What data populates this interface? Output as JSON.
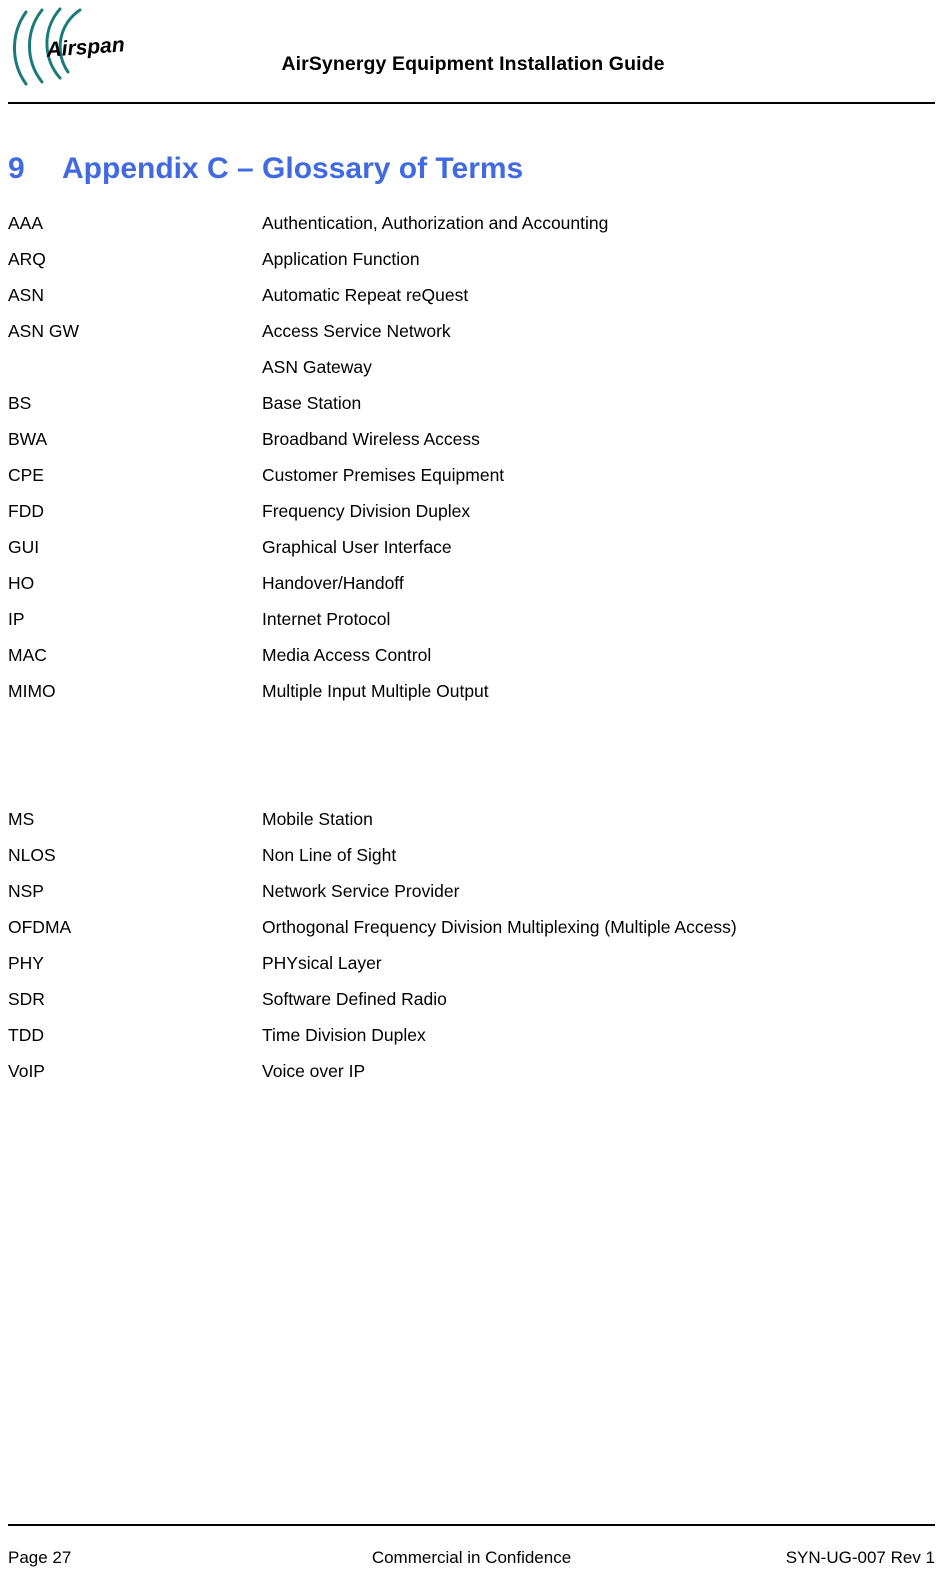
{
  "header": {
    "logo_text": "Airspan",
    "logo_arc_color": "#1a7a7a",
    "title": "AirSynergy Equipment Installation Guide"
  },
  "section": {
    "number": "9",
    "title": "Appendix C – Glossary of Terms",
    "heading_color": "#4169E1"
  },
  "glossary": {
    "rows": [
      {
        "term": "AAA",
        "definition": "Authentication, Authorization and Accounting"
      },
      {
        "term": "ARQ",
        "definition": "Application Function"
      },
      {
        "term": "ASN",
        "definition": "Automatic Repeat reQuest"
      },
      {
        "term": "ASN GW",
        "definition": "Access Service Network"
      },
      {
        "term": "",
        "definition": "ASN Gateway"
      },
      {
        "term": "BS",
        "definition": "Base Station"
      },
      {
        "term": "BWA",
        "definition": "Broadband Wireless Access"
      },
      {
        "term": "CPE",
        "definition": "Customer Premises Equipment"
      },
      {
        "term": "FDD",
        "definition": "Frequency Division Duplex"
      },
      {
        "term": "GUI",
        "definition": "Graphical User Interface"
      },
      {
        "term": "HO",
        "definition": "Handover/Handoff"
      },
      {
        "term": "IP",
        "definition": "Internet Protocol"
      },
      {
        "term": "MAC",
        "definition": "Media Access Control"
      },
      {
        "term": "MIMO",
        "definition": "Multiple Input Multiple Output"
      },
      {
        "term": "",
        "definition": ""
      },
      {
        "term": "",
        "definition": ""
      },
      {
        "term": "MS",
        "definition": "Mobile Station"
      },
      {
        "term": "NLOS",
        "definition": "Non Line of Sight"
      },
      {
        "term": "NSP",
        "definition": "Network Service Provider"
      },
      {
        "term": "OFDMA",
        "definition": "Orthogonal Frequency Division Multiplexing (Multiple Access)"
      },
      {
        "term": "PHY",
        "definition": "PHYsical Layer"
      },
      {
        "term": "SDR",
        "definition": "Software Defined Radio"
      },
      {
        "term": "TDD",
        "definition": "Time Division Duplex"
      },
      {
        "term": "VoIP",
        "definition": "Voice over IP"
      }
    ]
  },
  "footer": {
    "page": "Page 27",
    "confidentiality": "Commercial in Confidence",
    "document_id": "SYN-UG-007 Rev 1"
  }
}
